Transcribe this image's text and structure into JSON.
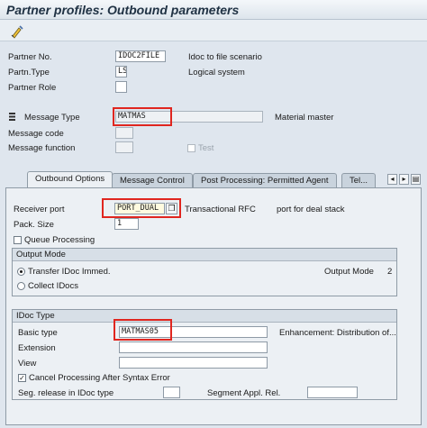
{
  "window": {
    "title": "Partner profiles: Outbound parameters"
  },
  "toolbar": {
    "tool_icon": "display-change-icon"
  },
  "header": {
    "partner_no": {
      "label": "Partner No.",
      "value": "IDOC2FILE",
      "desc": "Idoc to file scenario"
    },
    "partn_type": {
      "label": "Partn.Type",
      "value": "LS",
      "desc": "Logical system"
    },
    "partner_role": {
      "label": "Partner Role",
      "value": ""
    },
    "message_type": {
      "label": "Message Type",
      "value": "MATMAS",
      "desc": "Material master"
    },
    "message_code": {
      "label": "Message code",
      "value": ""
    },
    "message_function": {
      "label": "Message function",
      "value": ""
    },
    "test": {
      "label": "Test",
      "checked": false
    }
  },
  "tabs": [
    {
      "label": "Outbound Options",
      "active": true
    },
    {
      "label": "Message Control",
      "active": false
    },
    {
      "label": "Post Processing: Permitted Agent",
      "active": false
    },
    {
      "label": "Tel...",
      "active": false
    }
  ],
  "outbound": {
    "receiver_port": {
      "label": "Receiver port",
      "value": "PORT_DUAL",
      "desc1": "Transactional RFC",
      "desc2": "port for deal stack"
    },
    "pack_size": {
      "label": "Pack. Size",
      "value": "1"
    },
    "queue_processing": {
      "label": "Queue Processing",
      "checked": false
    },
    "output_mode": {
      "title": "Output Mode",
      "transfer": "Transfer IDoc Immed.",
      "collect": "Collect IDocs",
      "mode_label": "Output Mode",
      "mode_value": "2"
    },
    "idoc_type": {
      "title": "IDoc Type",
      "basic_type": {
        "label": "Basic type",
        "value": "MATMAS05"
      },
      "enhancement_text": "Enhancement: Distribution of...",
      "extension": {
        "label": "Extension",
        "value": ""
      },
      "view": {
        "label": "View",
        "value": ""
      },
      "cancel_processing": {
        "label": "Cancel Processing After Syntax Error",
        "checked": true
      },
      "seg_release": {
        "label": "Seg. release in IDoc type",
        "value": ""
      },
      "segment_appl_rel": {
        "label": "Segment Appl. Rel.",
        "value": ""
      }
    }
  },
  "colors": {
    "highlight": "#e0261f",
    "title_text": "#203244",
    "background": "#dfe6ee"
  }
}
